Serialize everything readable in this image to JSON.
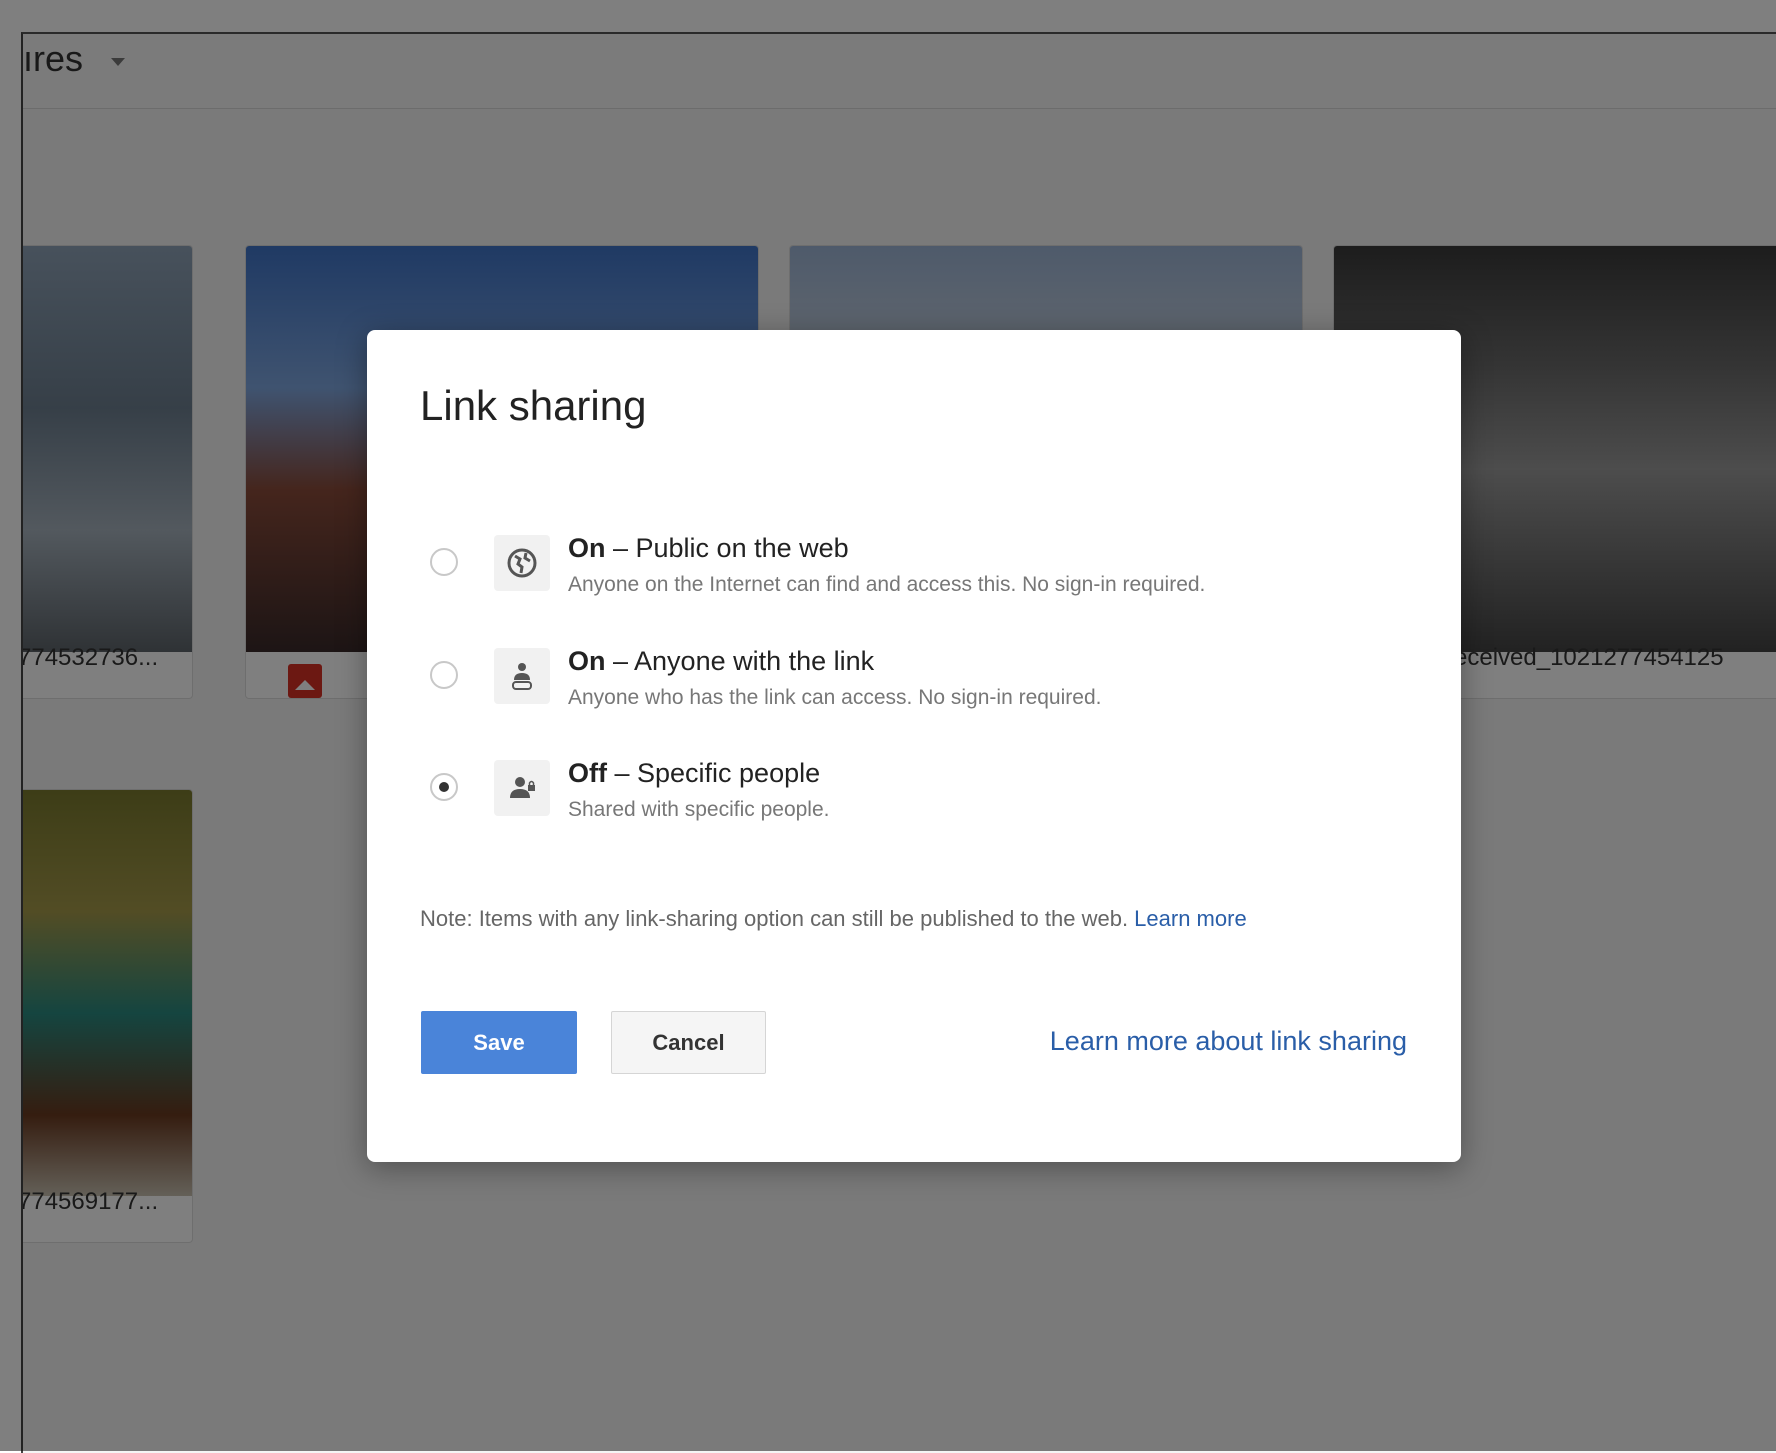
{
  "background": {
    "folder_title": "ıres",
    "files": [
      {
        "caption": "774532736..."
      },
      {
        "caption": ""
      },
      {
        "caption": ""
      },
      {
        "caption": "eceived_1021277454125"
      },
      {
        "caption": "774569177..."
      }
    ]
  },
  "dialog": {
    "title": "Link sharing",
    "options": [
      {
        "state": "On",
        "label": " – Public on the web",
        "description": "Anyone on the Internet can find and access this. No sign-in required.",
        "icon": "globe-icon",
        "selected": false
      },
      {
        "state": "On",
        "label": " – Anyone with the link",
        "description": "Anyone who has the link can access. No sign-in required.",
        "icon": "link-person-icon",
        "selected": false
      },
      {
        "state": "Off",
        "label": " – Specific people",
        "description": "Shared with specific people.",
        "icon": "person-lock-icon",
        "selected": true
      }
    ],
    "note": "Note: Items with any link-sharing option can still be published to the web. ",
    "note_link": "Learn more",
    "save_label": "Save",
    "cancel_label": "Cancel",
    "learn_more_sharing": "Learn more about link sharing"
  },
  "colors": {
    "accent": "#4a84d9",
    "link": "#2a5ea8",
    "scrim": "rgba(0,0,0,0.50)"
  }
}
